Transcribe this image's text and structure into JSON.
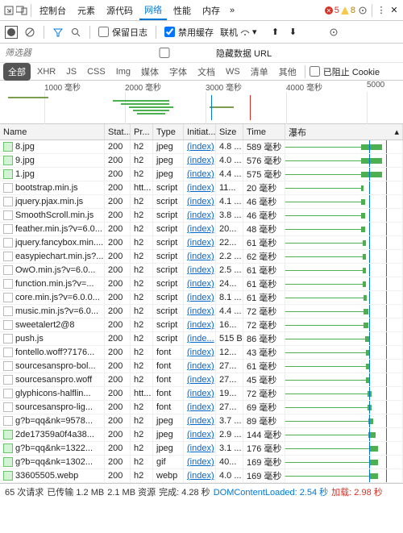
{
  "tabs": [
    "控制台",
    "元素",
    "源代码",
    "网络",
    "性能",
    "内存"
  ],
  "active_tab": 3,
  "errors": {
    "red_count": "5",
    "yellow_count": "8"
  },
  "toolbar": {
    "preserve_log": "保留日志",
    "disable_cache": "禁用缓存",
    "throttle": "联机"
  },
  "filter": {
    "placeholder": "筛选器",
    "hide_data_urls": "隐藏数据 URL"
  },
  "types": [
    "全部",
    "XHR",
    "JS",
    "CSS",
    "Img",
    "媒体",
    "字体",
    "文档",
    "WS",
    "清单",
    "其他"
  ],
  "blocked_cookies": "已阻止 Cookie",
  "timeline_ticks": [
    "1000 毫秒",
    "2000 毫秒",
    "3000 毫秒",
    "4000 毫秒",
    "5000"
  ],
  "headers": {
    "name": "Name",
    "status": "Stat...",
    "protocol": "Pr...",
    "type": "Type",
    "initiator": "Initiat...",
    "size": "Size",
    "time": "Time",
    "waterfall": "瀑布"
  },
  "rows": [
    {
      "icon": "img",
      "name": "8.jpg",
      "status": "200",
      "protocol": "h2",
      "type": "jpeg",
      "initiator": "(index)",
      "size": "4.8 ...",
      "time": "589 毫秒",
      "wf_start": 65,
      "wf_len": 18
    },
    {
      "icon": "img",
      "name": "9.jpg",
      "status": "200",
      "protocol": "h2",
      "type": "jpeg",
      "initiator": "(index)",
      "size": "4.0 ...",
      "time": "576 毫秒",
      "wf_start": 65,
      "wf_len": 18
    },
    {
      "icon": "img",
      "name": "1.jpg",
      "status": "200",
      "protocol": "h2",
      "type": "jpeg",
      "initiator": "(index)",
      "size": "4.4 ...",
      "time": "575 毫秒",
      "wf_start": 65,
      "wf_len": 18
    },
    {
      "icon": "doc",
      "name": "bootstrap.min.js",
      "status": "200",
      "protocol": "htt...",
      "type": "script",
      "initiator": "(index)",
      "size": "11...",
      "time": "20 毫秒",
      "wf_start": 65,
      "wf_len": 2
    },
    {
      "icon": "doc",
      "name": "jquery.pjax.min.js",
      "status": "200",
      "protocol": "h2",
      "type": "script",
      "initiator": "(index)",
      "size": "4.1 ...",
      "time": "46 毫秒",
      "wf_start": 65,
      "wf_len": 3
    },
    {
      "icon": "doc",
      "name": "SmoothScroll.min.js",
      "status": "200",
      "protocol": "h2",
      "type": "script",
      "initiator": "(index)",
      "size": "3.8 ...",
      "time": "46 毫秒",
      "wf_start": 65,
      "wf_len": 3
    },
    {
      "icon": "doc",
      "name": "feather.min.js?v=6.0...",
      "status": "200",
      "protocol": "h2",
      "type": "script",
      "initiator": "(index)",
      "size": "20...",
      "time": "48 毫秒",
      "wf_start": 65,
      "wf_len": 3
    },
    {
      "icon": "doc",
      "name": "jquery.fancybox.min....",
      "status": "200",
      "protocol": "h2",
      "type": "script",
      "initiator": "(index)",
      "size": "22...",
      "time": "61 毫秒",
      "wf_start": 66,
      "wf_len": 3
    },
    {
      "icon": "doc",
      "name": "easypiechart.min.js?...",
      "status": "200",
      "protocol": "h2",
      "type": "script",
      "initiator": "(index)",
      "size": "2.2 ...",
      "time": "62 毫秒",
      "wf_start": 66,
      "wf_len": 3
    },
    {
      "icon": "doc",
      "name": "OwO.min.js?v=6.0...",
      "status": "200",
      "protocol": "h2",
      "type": "script",
      "initiator": "(index)",
      "size": "2.5 ...",
      "time": "61 毫秒",
      "wf_start": 66,
      "wf_len": 3
    },
    {
      "icon": "doc",
      "name": "function.min.js?v=...",
      "status": "200",
      "protocol": "h2",
      "type": "script",
      "initiator": "(index)",
      "size": "24...",
      "time": "61 毫秒",
      "wf_start": 66,
      "wf_len": 3
    },
    {
      "icon": "doc",
      "name": "core.min.js?v=6.0.0...",
      "status": "200",
      "protocol": "h2",
      "type": "script",
      "initiator": "(index)",
      "size": "8.1 ...",
      "time": "61 毫秒",
      "wf_start": 67,
      "wf_len": 3
    },
    {
      "icon": "doc",
      "name": "music.min.js?v=6.0...",
      "status": "200",
      "protocol": "h2",
      "type": "script",
      "initiator": "(index)",
      "size": "4.4 ...",
      "time": "72 毫秒",
      "wf_start": 67,
      "wf_len": 4
    },
    {
      "icon": "doc",
      "name": "sweetalert2@8",
      "status": "200",
      "protocol": "h2",
      "type": "script",
      "initiator": "(index)",
      "size": "16...",
      "time": "72 毫秒",
      "wf_start": 67,
      "wf_len": 4
    },
    {
      "icon": "doc",
      "name": "push.js",
      "status": "200",
      "protocol": "h2",
      "type": "script",
      "initiator": "(inde...",
      "size": "515 B",
      "time": "86 毫秒",
      "wf_start": 68,
      "wf_len": 4
    },
    {
      "icon": "doc",
      "name": "fontello.woff?7176...",
      "status": "200",
      "protocol": "h2",
      "type": "font",
      "initiator": "(index)",
      "size": "12...",
      "time": "43 毫秒",
      "wf_start": 69,
      "wf_len": 3
    },
    {
      "icon": "doc",
      "name": "sourcesanspro-bol...",
      "status": "200",
      "protocol": "h2",
      "type": "font",
      "initiator": "(index)",
      "size": "27...",
      "time": "61 毫秒",
      "wf_start": 69,
      "wf_len": 3
    },
    {
      "icon": "doc",
      "name": "sourcesanspro.woff",
      "status": "200",
      "protocol": "h2",
      "type": "font",
      "initiator": "(index)",
      "size": "27...",
      "time": "45 毫秒",
      "wf_start": 69,
      "wf_len": 3
    },
    {
      "icon": "doc",
      "name": "glyphicons-halflin...",
      "status": "200",
      "protocol": "htt...",
      "type": "font",
      "initiator": "(index)",
      "size": "19...",
      "time": "72 毫秒",
      "wf_start": 70,
      "wf_len": 4
    },
    {
      "icon": "doc",
      "name": "sourcesanspro-lig...",
      "status": "200",
      "protocol": "h2",
      "type": "font",
      "initiator": "(index)",
      "size": "27...",
      "time": "69 毫秒",
      "wf_start": 70,
      "wf_len": 4
    },
    {
      "icon": "doc",
      "name": "g?b=qq&nk=9578...",
      "status": "200",
      "protocol": "h2",
      "type": "jpeg",
      "initiator": "(index)",
      "size": "3.7 ...",
      "time": "89 毫秒",
      "wf_start": 71,
      "wf_len": 4
    },
    {
      "icon": "img2",
      "name": "2de17359a0f4a38...",
      "status": "200",
      "protocol": "h2",
      "type": "jpeg",
      "initiator": "(index)",
      "size": "2.9 ...",
      "time": "144 毫秒",
      "wf_start": 71,
      "wf_len": 6
    },
    {
      "icon": "img2",
      "name": "g?b=qq&nk=1322...",
      "status": "200",
      "protocol": "h2",
      "type": "jpeg",
      "initiator": "(index)",
      "size": "3.1 ...",
      "time": "176 毫秒",
      "wf_start": 72,
      "wf_len": 7
    },
    {
      "icon": "img2",
      "name": "g?b=qq&nk=1302...",
      "status": "200",
      "protocol": "h2",
      "type": "gif",
      "initiator": "(index)",
      "size": "40...",
      "time": "169 毫秒",
      "wf_start": 72,
      "wf_len": 7
    },
    {
      "icon": "img2",
      "name": "33605505.webp",
      "status": "200",
      "protocol": "h2",
      "type": "webp",
      "initiator": "(index)",
      "size": "4.0 ...",
      "time": "169 毫秒",
      "wf_start": 72,
      "wf_len": 7
    }
  ],
  "status_bar": {
    "requests": "65 次请求",
    "transferred": "已传输 1.2 MB",
    "resources": "2.1 MB 资源",
    "finish": "完成: 4.28 秒",
    "dcl": "DOMContentLoaded: 2.54 秒",
    "load": "加载: 2.98 秒"
  }
}
